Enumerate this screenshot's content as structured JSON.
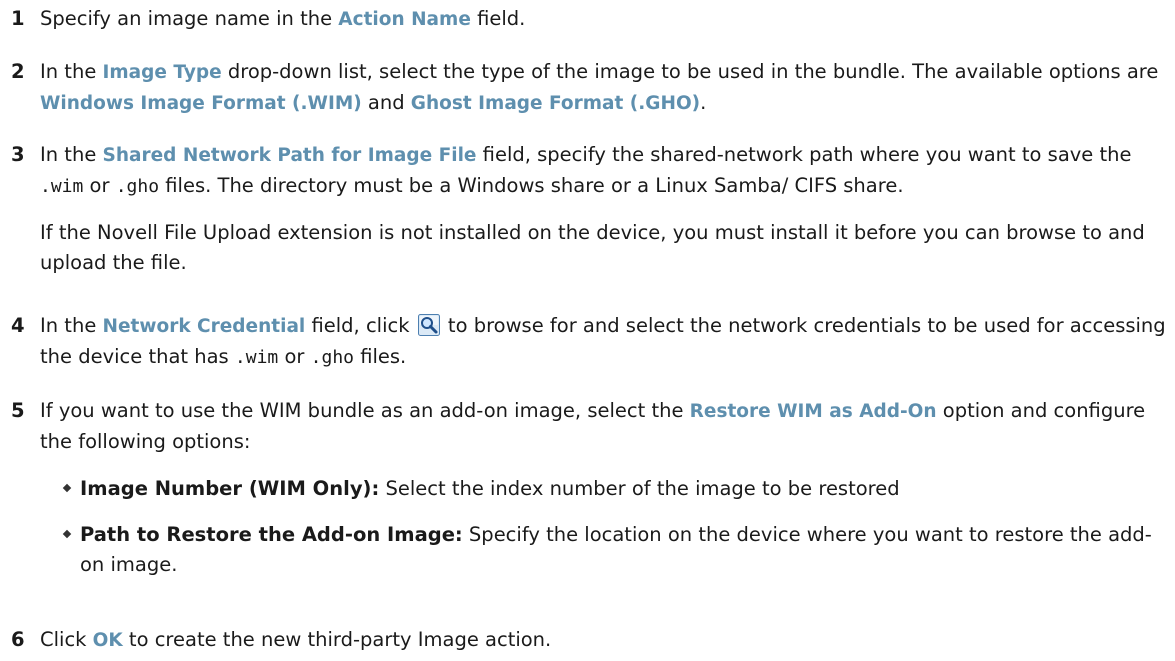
{
  "steps": [
    {
      "num": "1",
      "p1": "Specify an image name in the ",
      "ui1": "Action Name",
      "p2": " field."
    },
    {
      "num": "2",
      "p1": "In the ",
      "ui1": "Image Type",
      "p2": " drop-down list, select the type of the image to be used in the bundle. The available options are ",
      "ui2": "Windows Image Format (.WIM)",
      "p3": " and ",
      "ui3": "Ghost Image Format (.GHO)",
      "p4": "."
    },
    {
      "num": "3",
      "p1": "In the ",
      "ui1": "Shared Network Path for Image File",
      "p2": " field, specify the shared-network path where you want to save the ",
      "code1": ".wim",
      "p3": " or ",
      "code2": ".gho",
      "p4": " files. The directory must be a Windows share or a Linux Samba/ CIFS share.",
      "note": "If the Novell File Upload extension is not installed on the device, you must install it before you can browse to and upload the file."
    },
    {
      "num": "4",
      "p1": "In the ",
      "ui1": "Network Credential",
      "p2": " field, click ",
      "icon": "browse-search-icon",
      "p3": " to browse for and select the network credentials to be used for accessing the device that has ",
      "code1": ".wim",
      "p4": " or ",
      "code2": ".gho",
      "p5": " files."
    },
    {
      "num": "5",
      "p1": "If you want to use the WIM bundle as an add-on image, select the ",
      "ui1": "Restore WIM as Add-On",
      "p2": " option and configure the following options:",
      "bullets": [
        {
          "label": "Image Number (WIM Only):",
          "text": " Select the index number of the image to be restored"
        },
        {
          "label": "Path to Restore the Add-on Image:",
          "text": " Specify the location on the device where you want to restore the add-on image."
        }
      ]
    },
    {
      "num": "6",
      "p1": "Click ",
      "ui1": "OK",
      "p2": " to create the new third-party Image action."
    }
  ],
  "colors": {
    "ui_term": "#5e8fae",
    "text": "#1a1a1a"
  }
}
